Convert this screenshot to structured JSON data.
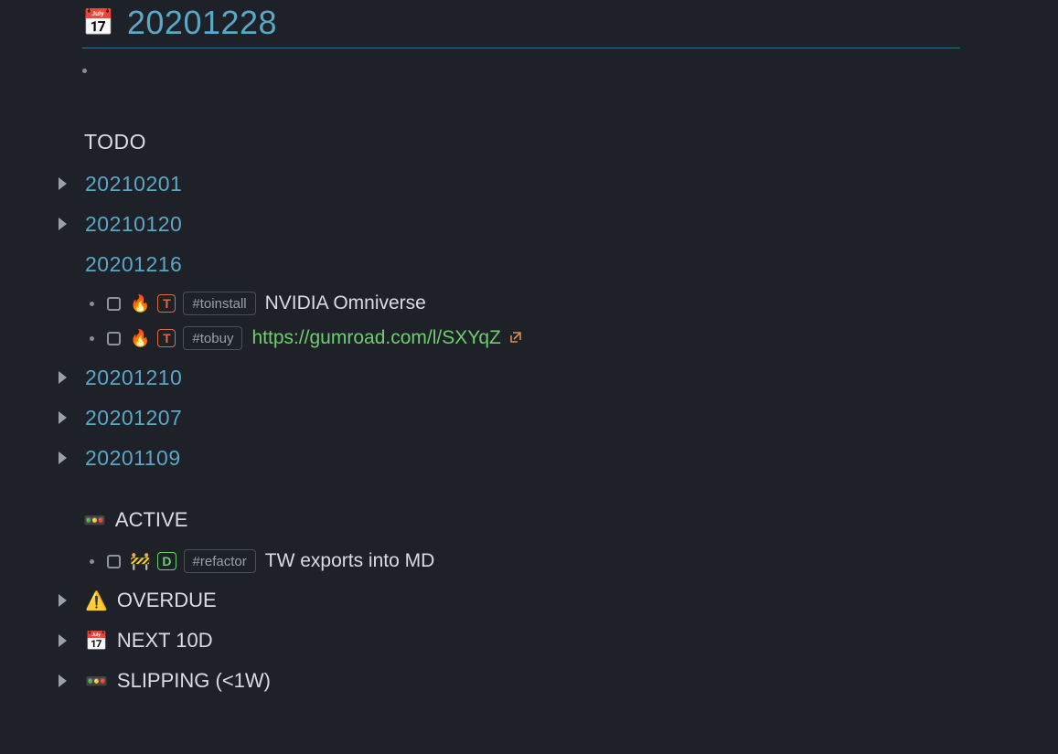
{
  "title": {
    "emoji": "📅",
    "text": "20201228"
  },
  "todo": {
    "heading": "TODO",
    "entries": [
      {
        "label": "20210201",
        "collapsed": true
      },
      {
        "label": "20210120",
        "collapsed": true
      },
      {
        "label": "20201216",
        "collapsed": false
      },
      {
        "label": "20201210",
        "collapsed": true
      },
      {
        "label": "20201207",
        "collapsed": true
      },
      {
        "label": "20201109",
        "collapsed": true
      }
    ],
    "tasks_20201216": [
      {
        "emoji": "🔥",
        "pill": "T",
        "tag": "#toinstall",
        "text": "NVIDIA Omniverse"
      },
      {
        "emoji": "🔥",
        "pill": "T",
        "tag": "#tobuy",
        "url": "https://gumroad.com/l/SXYqZ"
      }
    ]
  },
  "active": {
    "emoji": "🚥",
    "heading": "ACTIVE",
    "tasks": [
      {
        "emoji": "🚧",
        "pill": "D",
        "tag": "#refactor",
        "text": "TW exports into MD"
      }
    ]
  },
  "overdue": {
    "emoji": "⚠️",
    "heading": "OVERDUE"
  },
  "next10d": {
    "emoji": "📅",
    "heading": "NEXT 10D"
  },
  "slipping": {
    "emoji": "🚥",
    "heading": "SLIPPING (<1W)"
  },
  "icons": {
    "external": "↗"
  }
}
